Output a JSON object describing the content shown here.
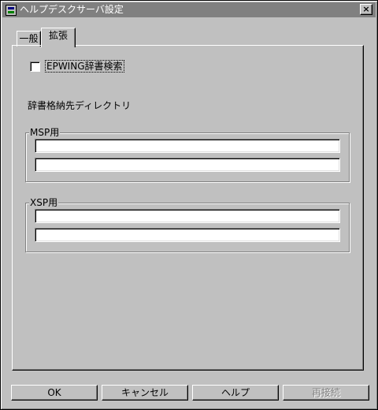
{
  "window": {
    "title": "ヘルプデスクサーバ設定",
    "close_label": "×"
  },
  "tabs": [
    {
      "label": "一般",
      "selected": false
    },
    {
      "label": "拡張",
      "selected": true
    }
  ],
  "epwing": {
    "label": "EPWING辞書検索",
    "checked": false
  },
  "dir_section_label": "辞書格納先ディレクトリ",
  "msp": {
    "title": "MSP用",
    "field1": "",
    "field2": ""
  },
  "xsp": {
    "title": "XSP用",
    "field1": "",
    "field2": ""
  },
  "buttons": {
    "ok": "OK",
    "cancel": "キャンセル",
    "help": "ヘルプ",
    "reconnect": "再接続"
  },
  "reconnect_enabled": false
}
